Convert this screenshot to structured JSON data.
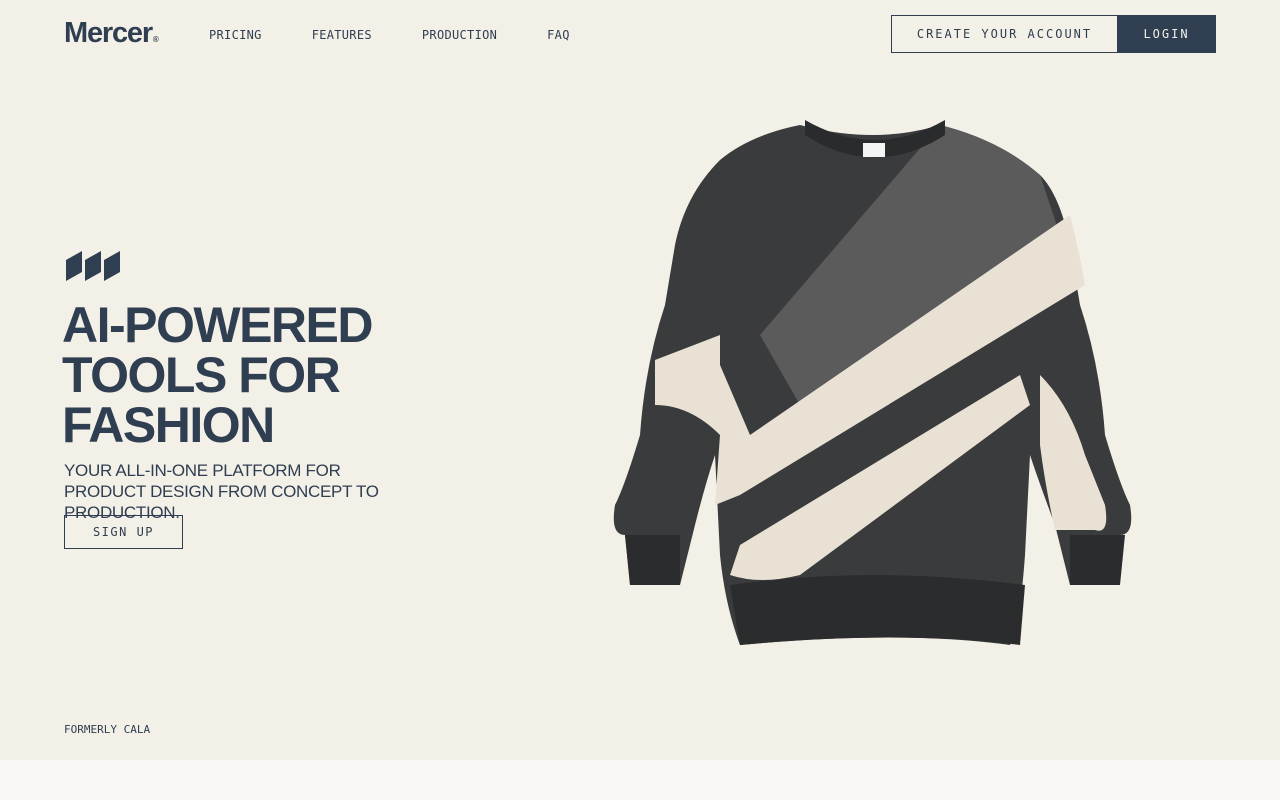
{
  "header": {
    "logo": "Mercer",
    "logo_mark": "®",
    "nav": [
      "PRICING",
      "FEATURES",
      "PRODUCTION",
      "FAQ"
    ],
    "create_account_label": "CREATE YOUR ACCOUNT",
    "login_label": "LOGIN"
  },
  "hero": {
    "title_lines": [
      "AI-POWERED",
      "TOOLS FOR",
      "FASHION"
    ],
    "subtitle": "YOUR ALL-IN-ONE PLATFORM FOR PRODUCT DESIGN FROM CONCEPT TO PRODUCTION.",
    "cta_label": "SIGN UP",
    "brand_icon": "triple-slash-logo-icon",
    "image": "crewneck-sweater-image"
  },
  "footer": {
    "formerly": "FORMERLY CALA"
  },
  "colors": {
    "background": "#f3f0e8",
    "primary": "#2f3e50",
    "band": "#f9f8f5"
  }
}
